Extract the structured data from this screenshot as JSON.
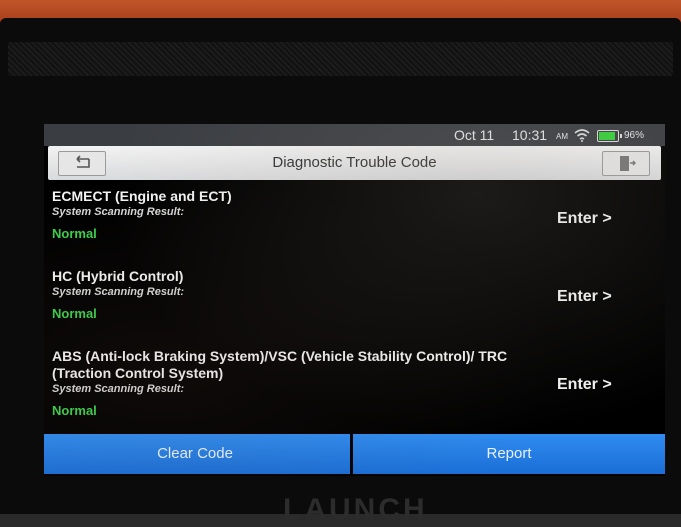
{
  "device": {
    "brand": "LAUNCH"
  },
  "status_bar": {
    "date": "Oct 11",
    "time": "10:31",
    "ampm": "AM",
    "battery": "96%"
  },
  "header": {
    "title": "Diagnostic Trouble Code"
  },
  "systems": [
    {
      "name": "ECMECT (Engine and ECT)",
      "result_label": "System Scanning Result:",
      "result": "Normal",
      "action": "Enter >"
    },
    {
      "name": "HC (Hybrid Control)",
      "result_label": "System Scanning Result:",
      "result": "Normal",
      "action": "Enter >"
    },
    {
      "name": "ABS (Anti-lock Braking System)/VSC (Vehicle Stability Control)/ TRC (Traction Control System)",
      "result_label": "System Scanning Result:",
      "result": "Normal",
      "action": "Enter >"
    }
  ],
  "footer": {
    "clear_label": "Clear Code",
    "report_label": "Report"
  },
  "colors": {
    "accent": "#1a6ed6",
    "normal": "#3ad14a",
    "battery": "#36d13a"
  }
}
